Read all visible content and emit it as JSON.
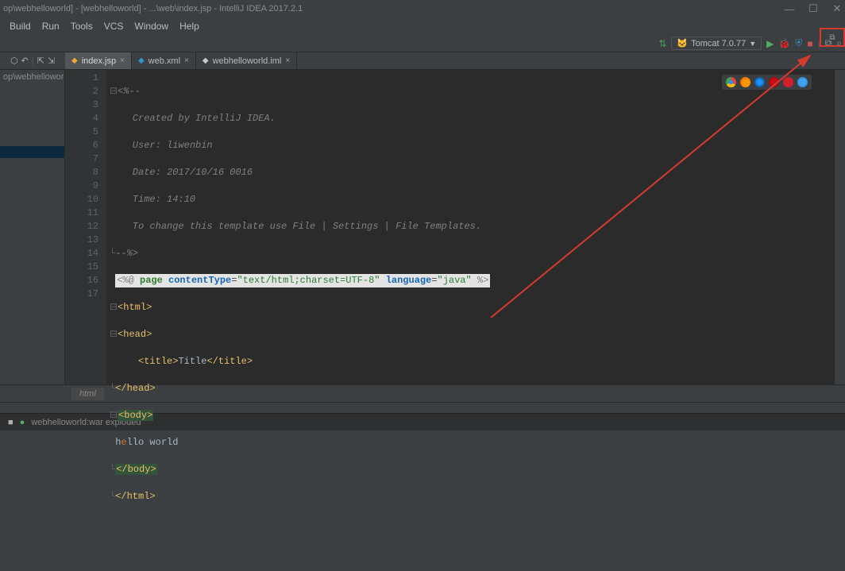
{
  "window": {
    "title": "op\\webhelloworld] - [webhelloworld] - ...\\web\\index.jsp - IntelliJ IDEA 2017.2.1"
  },
  "menu": {
    "build": "Build",
    "run": "Run",
    "tools": "Tools",
    "vcs": "VCS",
    "window": "Window",
    "help": "Help"
  },
  "run_config": {
    "label": "Tomcat 7.0.77"
  },
  "left_panel": {
    "proj_label": "op\\webhelloworld"
  },
  "tabs": [
    {
      "label": "index.jsp",
      "type": "jsp",
      "active": true
    },
    {
      "label": "web.xml",
      "type": "xml",
      "active": false
    },
    {
      "label": "webhelloworld.iml",
      "type": "iml",
      "active": false
    }
  ],
  "editor": {
    "lines": {
      "l1": "<%--",
      "l2": "  Created by IntelliJ IDEA.",
      "l3": "  User: liwenbin",
      "l4": "  Date: 2017/10/16 0016",
      "l5": "  Time: 14:10",
      "l6": "  To change this template use File | Settings | File Templates.",
      "l7": "--%>",
      "l8_delim_open": "<%@ ",
      "l8_page": "page",
      "l8_ct_attr": "contentType",
      "l8_ct_val": "\"text/html;charset=UTF-8\"",
      "l8_lang_attr": "language",
      "l8_lang_val": "\"java\"",
      "l8_delim_close": " %>",
      "l9": "<html>",
      "l10": "<head>",
      "l11_open": "<title>",
      "l11_text": "Title",
      "l11_close": "</title>",
      "l12": "</head>",
      "l13": "<body>",
      "l14_pre": "h",
      "l14_post": "llo world",
      "l15": "</body>",
      "l16": "</html>"
    },
    "line_numbers": [
      "1",
      "2",
      "3",
      "4",
      "5",
      "6",
      "7",
      "8",
      "9",
      "10",
      "11",
      "12",
      "13",
      "14",
      "15",
      "16",
      "17"
    ]
  },
  "breadcrumb": {
    "item": "html"
  },
  "status": {
    "text": "webhelloworld:war exploded"
  }
}
